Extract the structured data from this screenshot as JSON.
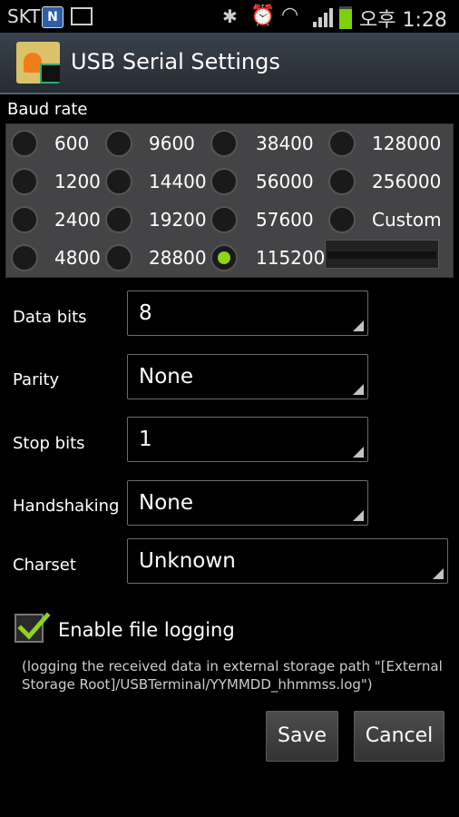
{
  "status_bar": {
    "carrier": "SKT",
    "notification_letter": "N",
    "time": "오후 1:28",
    "icons": [
      "notification-n-icon",
      "gallery-icon",
      "bluetooth-icon",
      "alarm-icon",
      "wifi-icon",
      "signal-icon",
      "battery-icon"
    ]
  },
  "title_bar": {
    "title": "USB Serial Settings"
  },
  "baud": {
    "label": "Baud rate",
    "options": [
      "600",
      "9600",
      "38400",
      "128000",
      "1200",
      "14400",
      "56000",
      "256000",
      "2400",
      "19200",
      "57600",
      "Custom",
      "4800",
      "28800",
      "115200"
    ],
    "selected": "115200",
    "custom_value": ""
  },
  "form": {
    "data_bits": {
      "label": "Data bits",
      "value": "8"
    },
    "parity": {
      "label": "Parity",
      "value": "None"
    },
    "stop_bits": {
      "label": "Stop bits",
      "value": "1"
    },
    "handshaking": {
      "label": "Handshaking",
      "value": "None"
    },
    "charset": {
      "label": "Charset",
      "value": "Unknown"
    }
  },
  "logging": {
    "checked": true,
    "label": "Enable file logging",
    "note": "(logging the received data in external storage path \"[External Storage Root]/USBTerminal/YYMMDD_hhmmss.log\")"
  },
  "buttons": {
    "save": "Save",
    "cancel": "Cancel"
  },
  "colors": {
    "accent": "#8fd21f",
    "panel": "#444446"
  }
}
